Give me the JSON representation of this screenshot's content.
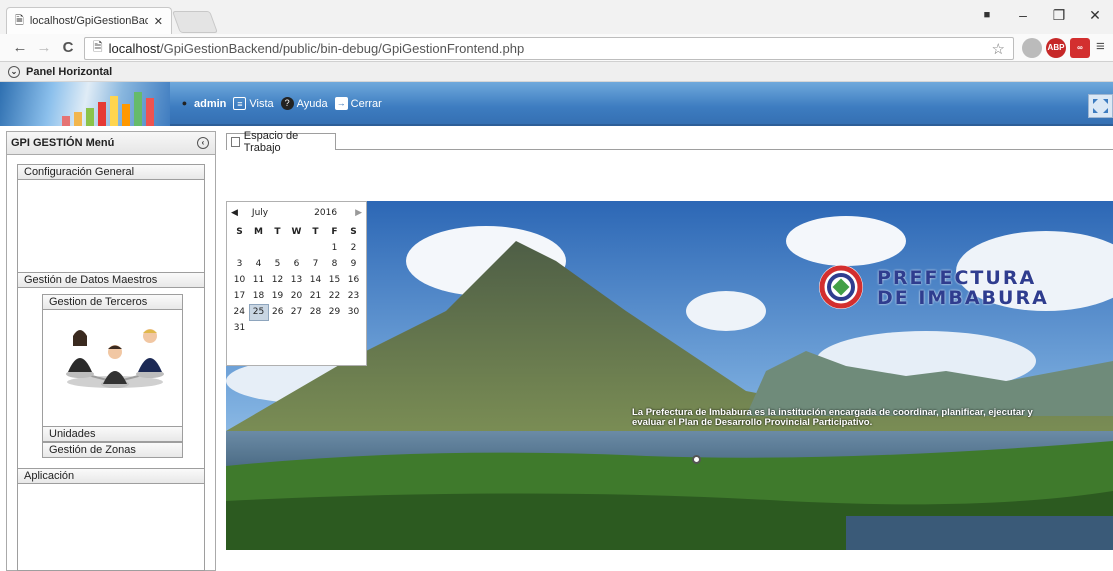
{
  "browser": {
    "tab_title": "localhost/GpiGestionBacke",
    "url_host": "localhost",
    "url_path": "/GpiGestionBackend/public/bin-debug/GpiGestionFrontend.php"
  },
  "app": {
    "panel_title": "Panel Horizontal",
    "menu": {
      "user": "admin",
      "view": "Vista",
      "help": "Ayuda",
      "close": "Cerrar"
    },
    "sidebar": {
      "title": "GPI GESTIÓN Menú",
      "sections": [
        {
          "label": "Configuración General"
        },
        {
          "label": "Gestión de Datos Maestros"
        },
        {
          "label": "Aplicación"
        }
      ],
      "sub_items": [
        {
          "label": "Gestion de Terceros"
        },
        {
          "label": "Unidades"
        },
        {
          "label": "Gestión de Zonas"
        }
      ]
    },
    "workspace_tab": "Espacio de Trabajo",
    "calendar": {
      "month": "July",
      "year": "2016",
      "weekdays": [
        "S",
        "M",
        "T",
        "W",
        "T",
        "F",
        "S"
      ],
      "weeks": [
        [
          "",
          "",
          "",
          "",
          "",
          "1",
          "2"
        ],
        [
          "3",
          "4",
          "5",
          "6",
          "7",
          "8",
          "9"
        ],
        [
          "10",
          "11",
          "12",
          "13",
          "14",
          "15",
          "16"
        ],
        [
          "17",
          "18",
          "19",
          "20",
          "21",
          "22",
          "23"
        ],
        [
          "24",
          "25",
          "26",
          "27",
          "28",
          "29",
          "30"
        ],
        [
          "31",
          "",
          "",
          "",
          "",
          "",
          ""
        ]
      ],
      "selected_day": "25"
    },
    "banner": {
      "brand_line1": "PREFECTURA",
      "brand_line2": "DE IMBABURA",
      "caption": "La Prefectura de Imbabura es la institución encargada de coordinar, planificar, ejecutar y evaluar el Plan de Desarrollo Provincial Participativo."
    }
  }
}
